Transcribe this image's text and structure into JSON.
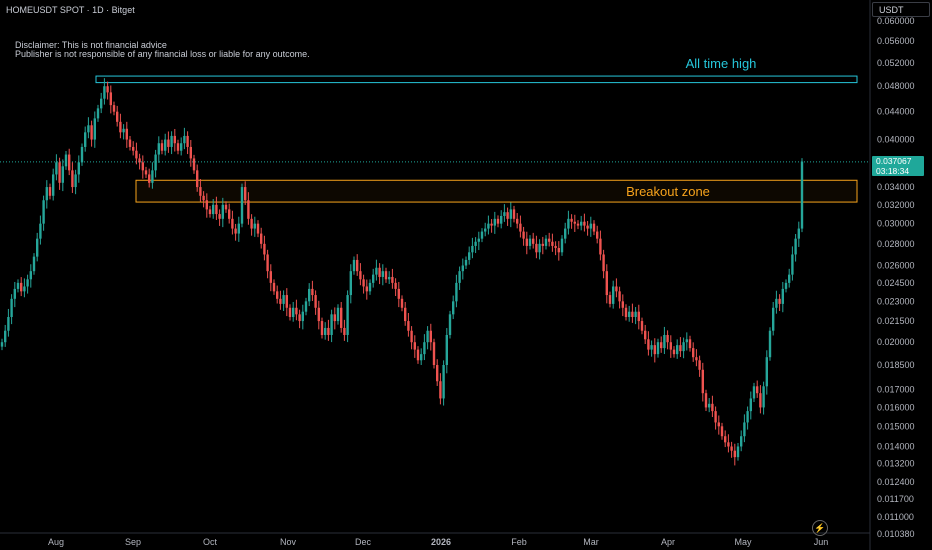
{
  "header": {
    "symbol_line": "HOMEUSDT SPOT · 1D · Bitget"
  },
  "disclaimer": {
    "line1": "Disclaimer: This is not financial advice",
    "line2": "Publisher is not responsible of any financial loss or liable for any outcome."
  },
  "currency_button": "USDT",
  "last_price": {
    "value": "0.037067",
    "countdown": "03:18:34"
  },
  "colors": {
    "up": "#26a69a",
    "down": "#ef5350",
    "ath": "#26c6da",
    "breakout": "#f7a31c",
    "background": "#000000"
  },
  "chart_data": {
    "type": "candlestick",
    "title": "",
    "y_scale": "log",
    "ylim": [
      0.01038,
      0.062
    ],
    "y_ticks": [
      "0.060000",
      "0.056000",
      "0.052000",
      "0.048000",
      "0.044000",
      "0.040000",
      "0.037067",
      "0.034000",
      "0.032000",
      "0.030000",
      "0.028000",
      "0.026000",
      "0.024500",
      "0.023000",
      "0.021500",
      "0.020000",
      "0.018500",
      "0.017000",
      "0.016000",
      "0.015000",
      "0.014000",
      "0.013200",
      "0.012400",
      "0.011700",
      "0.011000",
      "0.010380"
    ],
    "x_ticks": [
      "Aug",
      "Sep",
      "Oct",
      "Nov",
      "Dec",
      "2026",
      "Feb",
      "Mar",
      "Apr",
      "May",
      "Jun"
    ],
    "annotations": [
      {
        "label": "All time high",
        "price_low": 0.0486,
        "price_high": 0.0497
      },
      {
        "label": "Breakout zone",
        "price_low": 0.0323,
        "price_high": 0.0348
      }
    ],
    "closes": [
      0.02,
      0.0208,
      0.0218,
      0.0232,
      0.024,
      0.0245,
      0.0238,
      0.0242,
      0.0248,
      0.0255,
      0.0268,
      0.0285,
      0.03,
      0.0325,
      0.034,
      0.033,
      0.0355,
      0.037,
      0.0345,
      0.0365,
      0.038,
      0.036,
      0.034,
      0.0355,
      0.037,
      0.039,
      0.041,
      0.042,
      0.04,
      0.043,
      0.0445,
      0.046,
      0.048,
      0.047,
      0.045,
      0.044,
      0.0425,
      0.041,
      0.0415,
      0.04,
      0.039,
      0.0385,
      0.0375,
      0.037,
      0.036,
      0.0355,
      0.0345,
      0.036,
      0.038,
      0.0395,
      0.0385,
      0.04,
      0.039,
      0.0405,
      0.0395,
      0.0385,
      0.0395,
      0.0405,
      0.039,
      0.0375,
      0.036,
      0.034,
      0.033,
      0.0325,
      0.0315,
      0.031,
      0.032,
      0.031,
      0.0305,
      0.032,
      0.0315,
      0.0305,
      0.0295,
      0.029,
      0.03,
      0.034,
      0.0325,
      0.0305,
      0.0295,
      0.03,
      0.029,
      0.028,
      0.027,
      0.0255,
      0.0245,
      0.0238,
      0.0232,
      0.0228,
      0.0235,
      0.0225,
      0.0218,
      0.0225,
      0.022,
      0.0215,
      0.0222,
      0.023,
      0.024,
      0.0235,
      0.0225,
      0.0215,
      0.0205,
      0.021,
      0.0205,
      0.022,
      0.0215,
      0.0225,
      0.021,
      0.0205,
      0.0235,
      0.0255,
      0.0265,
      0.0255,
      0.0248,
      0.0242,
      0.0238,
      0.0245,
      0.0252,
      0.0258,
      0.025,
      0.0255,
      0.0248,
      0.025,
      0.0245,
      0.024,
      0.0232,
      0.0225,
      0.0215,
      0.0208,
      0.02,
      0.0195,
      0.0188,
      0.0192,
      0.02,
      0.0208,
      0.02,
      0.0185,
      0.0175,
      0.0165,
      0.0185,
      0.0205,
      0.022,
      0.023,
      0.0245,
      0.0255,
      0.026,
      0.0265,
      0.0272,
      0.0278,
      0.0282,
      0.0285,
      0.0292,
      0.0295,
      0.03,
      0.0298,
      0.0305,
      0.03,
      0.0308,
      0.0312,
      0.0305,
      0.0315,
      0.0305,
      0.03,
      0.0292,
      0.0285,
      0.0278,
      0.0285,
      0.028,
      0.0272,
      0.028,
      0.0278,
      0.0285,
      0.0282,
      0.0278,
      0.0276,
      0.0272,
      0.0285,
      0.0295,
      0.0305,
      0.0302,
      0.03,
      0.0298,
      0.0302,
      0.0298,
      0.0295,
      0.03,
      0.0292,
      0.0285,
      0.027,
      0.0255,
      0.0235,
      0.0228,
      0.0242,
      0.0238,
      0.023,
      0.0225,
      0.0218,
      0.0222,
      0.0218,
      0.0222,
      0.0215,
      0.0208,
      0.0202,
      0.0195,
      0.0198,
      0.0192,
      0.02,
      0.0196,
      0.0205,
      0.02,
      0.0195,
      0.0192,
      0.0198,
      0.0194,
      0.02,
      0.0202,
      0.0196,
      0.019,
      0.0188,
      0.0182,
      0.0168,
      0.016,
      0.0162,
      0.0158,
      0.0152,
      0.015,
      0.0145,
      0.0142,
      0.014,
      0.0138,
      0.0135,
      0.014,
      0.0145,
      0.0152,
      0.0158,
      0.0165,
      0.0172,
      0.0168,
      0.016,
      0.0172,
      0.019,
      0.0208,
      0.0225,
      0.0232,
      0.0228,
      0.024,
      0.0245,
      0.0252,
      0.027,
      0.0285,
      0.0295,
      0.0371
    ]
  }
}
